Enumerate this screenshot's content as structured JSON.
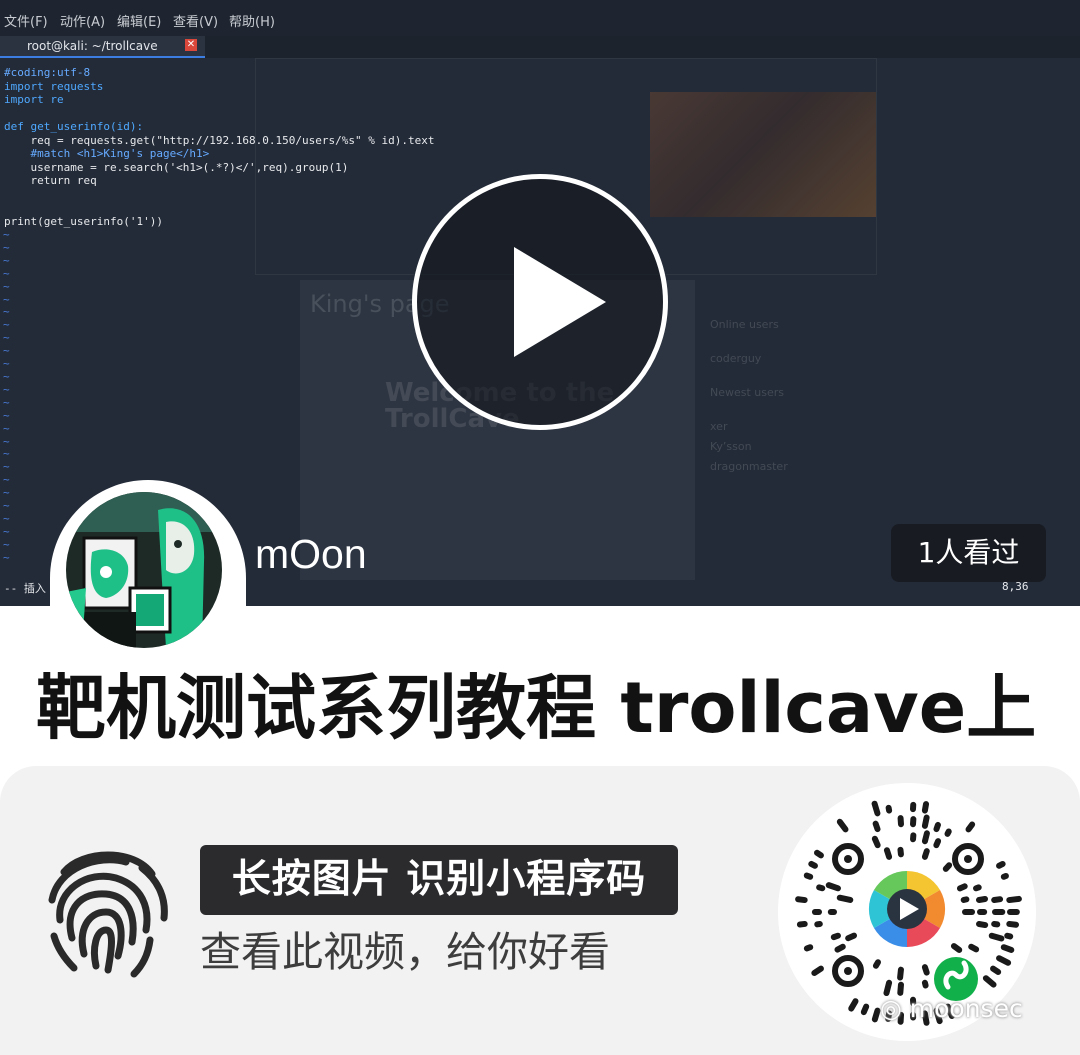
{
  "terminal": {
    "menu": [
      "文件(F)",
      "动作(A)",
      "编辑(E)",
      "查看(V)",
      "帮助(H)"
    ],
    "tab_title": "root@kali: ~/trollcave",
    "close_glyph": "✕",
    "code_lines": [
      "#coding:utf-8",
      "import requests",
      "import re",
      "",
      "def get_userinfo(id):",
      "    req = requests.get(\"http://192.168.0.150/users/%s\" % id).text",
      "    #match <h1>King's page</h1>",
      "    username = re.search('<h1>(.*?)</',req).group(1)",
      "    return req",
      "",
      "",
      "print(get_userinfo('1'))"
    ],
    "status_left": "-- 插入 --",
    "cursor_pos": "8,36",
    "background_page": {
      "title": "King's page",
      "welcome": "Welcome to the TrollCave",
      "sidebar": [
        "Online users",
        "coderguy",
        "Newest users",
        "xer",
        "Ky’sson",
        "dragonmaster"
      ]
    }
  },
  "video": {
    "views": "1人看过",
    "author": "mOon",
    "title": "靶机测试系列教程 trollcave上"
  },
  "mini_program": {
    "press_text": "长按图片 识别小程序码",
    "subtitle": "查看此视频，给你好看",
    "watermark": "moonsec"
  },
  "icons": [
    "play-icon",
    "fingerprint-icon",
    "miniprogram-qr-icon",
    "wechat-logo-icon"
  ],
  "colors": {
    "terminal_bg": "#232b38",
    "keyword": "#4fa8ff",
    "string": "#e07a7a",
    "tab_accent": "#3b7de0",
    "badge_bg": "#2b2b2e"
  }
}
